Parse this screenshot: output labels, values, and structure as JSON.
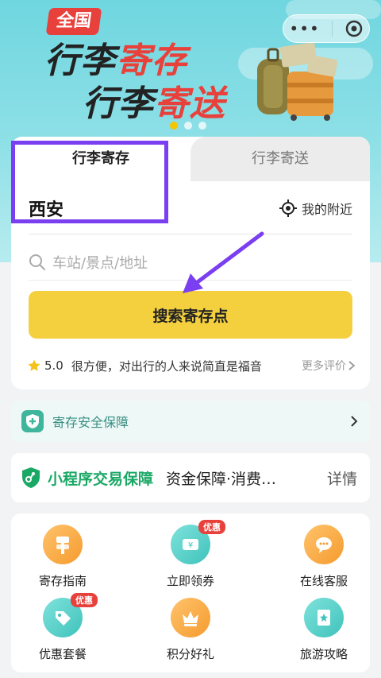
{
  "banner": {
    "tag": "全国",
    "line1_dark": "行李",
    "line1_red": "寄存",
    "line2_dark": "行李",
    "line2_red": "寄送",
    "dots": 3,
    "active_dot": 0
  },
  "capsule": {
    "more": "•••"
  },
  "tabs": {
    "left": "行李寄存",
    "right": "行李寄送"
  },
  "location": {
    "city": "西安",
    "nearby": "我的附近"
  },
  "search": {
    "placeholder": "车站/景点/地址",
    "button": "搜索寄存点"
  },
  "review": {
    "score": "5.0",
    "text": "很方便，对出行的人来说简直是福音",
    "more": "更多评价"
  },
  "safety": {
    "label": "寄存安全保障"
  },
  "guarantee": {
    "title": "小程序交易保障",
    "desc": "资金保障·消费…",
    "detail": "详情"
  },
  "services": [
    {
      "label": "寄存指南",
      "badge": ""
    },
    {
      "label": "立即领券",
      "badge": "优惠"
    },
    {
      "label": "在线客服",
      "badge": ""
    },
    {
      "label": "优惠套餐",
      "badge": "优惠"
    },
    {
      "label": "积分好礼",
      "badge": ""
    },
    {
      "label": "旅游攻略",
      "badge": ""
    }
  ],
  "colors": {
    "accent_yellow": "#f4d03f",
    "brand_red": "#e8413c",
    "annotation_purple": "#7a3ff0",
    "green": "#1aa865"
  }
}
